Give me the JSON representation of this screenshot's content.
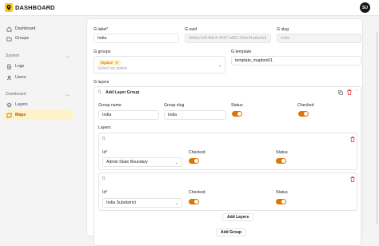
{
  "app": {
    "title": "DASHBOARD",
    "avatar": "SU"
  },
  "sidebar": {
    "items_top": [
      {
        "label": "Dashboard",
        "icon": "home-icon"
      },
      {
        "label": "Groups",
        "icon": "folder-icon"
      }
    ],
    "system": {
      "title": "System",
      "items": [
        {
          "label": "Logs",
          "icon": "document-icon"
        },
        {
          "label": "Users",
          "icon": "user-icon"
        }
      ]
    },
    "dashboard": {
      "title": "Dashboard",
      "items": [
        {
          "label": "Layers",
          "icon": "layers-icon"
        },
        {
          "label": "Maps",
          "icon": "map-icon",
          "active": true
        }
      ]
    }
  },
  "form": {
    "label": {
      "title": "G label",
      "value": "India"
    },
    "uuid": {
      "title": "G uuid",
      "value": "0d5bc7d0-8d14-4267-a8f3-164e41a8a3a2"
    },
    "slug": {
      "title": "G slug",
      "value": "india"
    },
    "groups": {
      "title": "G groups",
      "tag": "Mywise",
      "placeholder": "Select an option"
    },
    "template": {
      "title": "G template",
      "value": "template_mapbox01"
    },
    "layers_title": "G layers",
    "layer_group": {
      "header": "Add Layer Group",
      "group_name": {
        "title": "Group name",
        "value": "India"
      },
      "group_slug": {
        "title": "Group slug",
        "value": "india"
      },
      "status_label": "Status",
      "checked_label": "Checked",
      "layers_label": "Layers",
      "layers": [
        {
          "id_label": "Id",
          "id_value": "Admin State Boundary",
          "checked_label": "Checked",
          "status_label": "Status"
        },
        {
          "id_label": "Id",
          "id_value": "India Subdistrict",
          "checked_label": "Checked",
          "status_label": "Status"
        }
      ],
      "add_layers": "Add Layers"
    },
    "add_group": "Add Group"
  },
  "colors": {
    "accent": "#d97706",
    "accent_soft": "#fef3c7",
    "danger": "#dc2626"
  }
}
